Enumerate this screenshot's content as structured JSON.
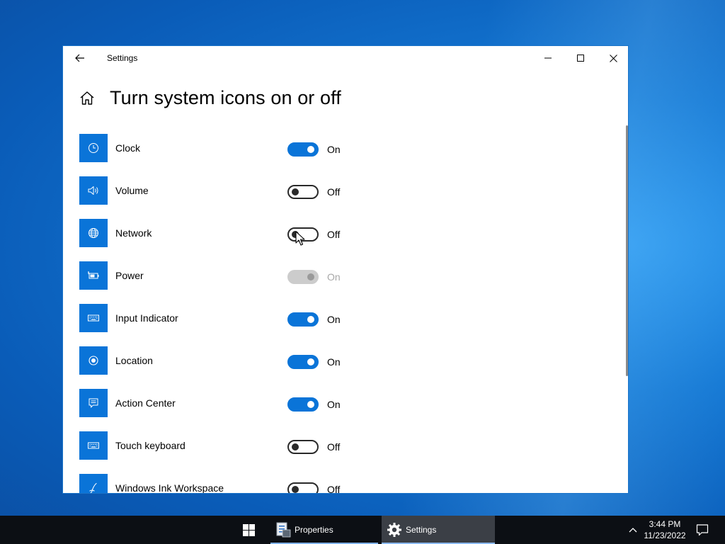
{
  "window": {
    "title": "Settings"
  },
  "page": {
    "title": "Turn system icons on or off"
  },
  "items": [
    {
      "label": "Clock",
      "state": "On",
      "toggle": "on",
      "icon": "clock-icon"
    },
    {
      "label": "Volume",
      "state": "Off",
      "toggle": "off",
      "icon": "volume-icon"
    },
    {
      "label": "Network",
      "state": "Off",
      "toggle": "off",
      "icon": "globe-icon"
    },
    {
      "label": "Power",
      "state": "On",
      "toggle": "disabled",
      "icon": "battery-icon"
    },
    {
      "label": "Input Indicator",
      "state": "On",
      "toggle": "on",
      "icon": "keyboard-icon"
    },
    {
      "label": "Location",
      "state": "On",
      "toggle": "on",
      "icon": "location-icon"
    },
    {
      "label": "Action Center",
      "state": "On",
      "toggle": "on",
      "icon": "message-icon"
    },
    {
      "label": "Touch keyboard",
      "state": "Off",
      "toggle": "off",
      "icon": "keyboard-icon"
    },
    {
      "label": "Windows Ink Workspace",
      "state": "Off",
      "toggle": "off",
      "icon": "pen-icon"
    }
  ],
  "taskbar": {
    "items": [
      {
        "label": "Properties",
        "icon": "properties-icon"
      },
      {
        "label": "Settings",
        "icon": "gear-icon"
      }
    ],
    "time": "3:44 PM",
    "date": "11/23/2022"
  },
  "colors": {
    "accent": "#0a74d8",
    "taskbar": "#0c0f14"
  }
}
